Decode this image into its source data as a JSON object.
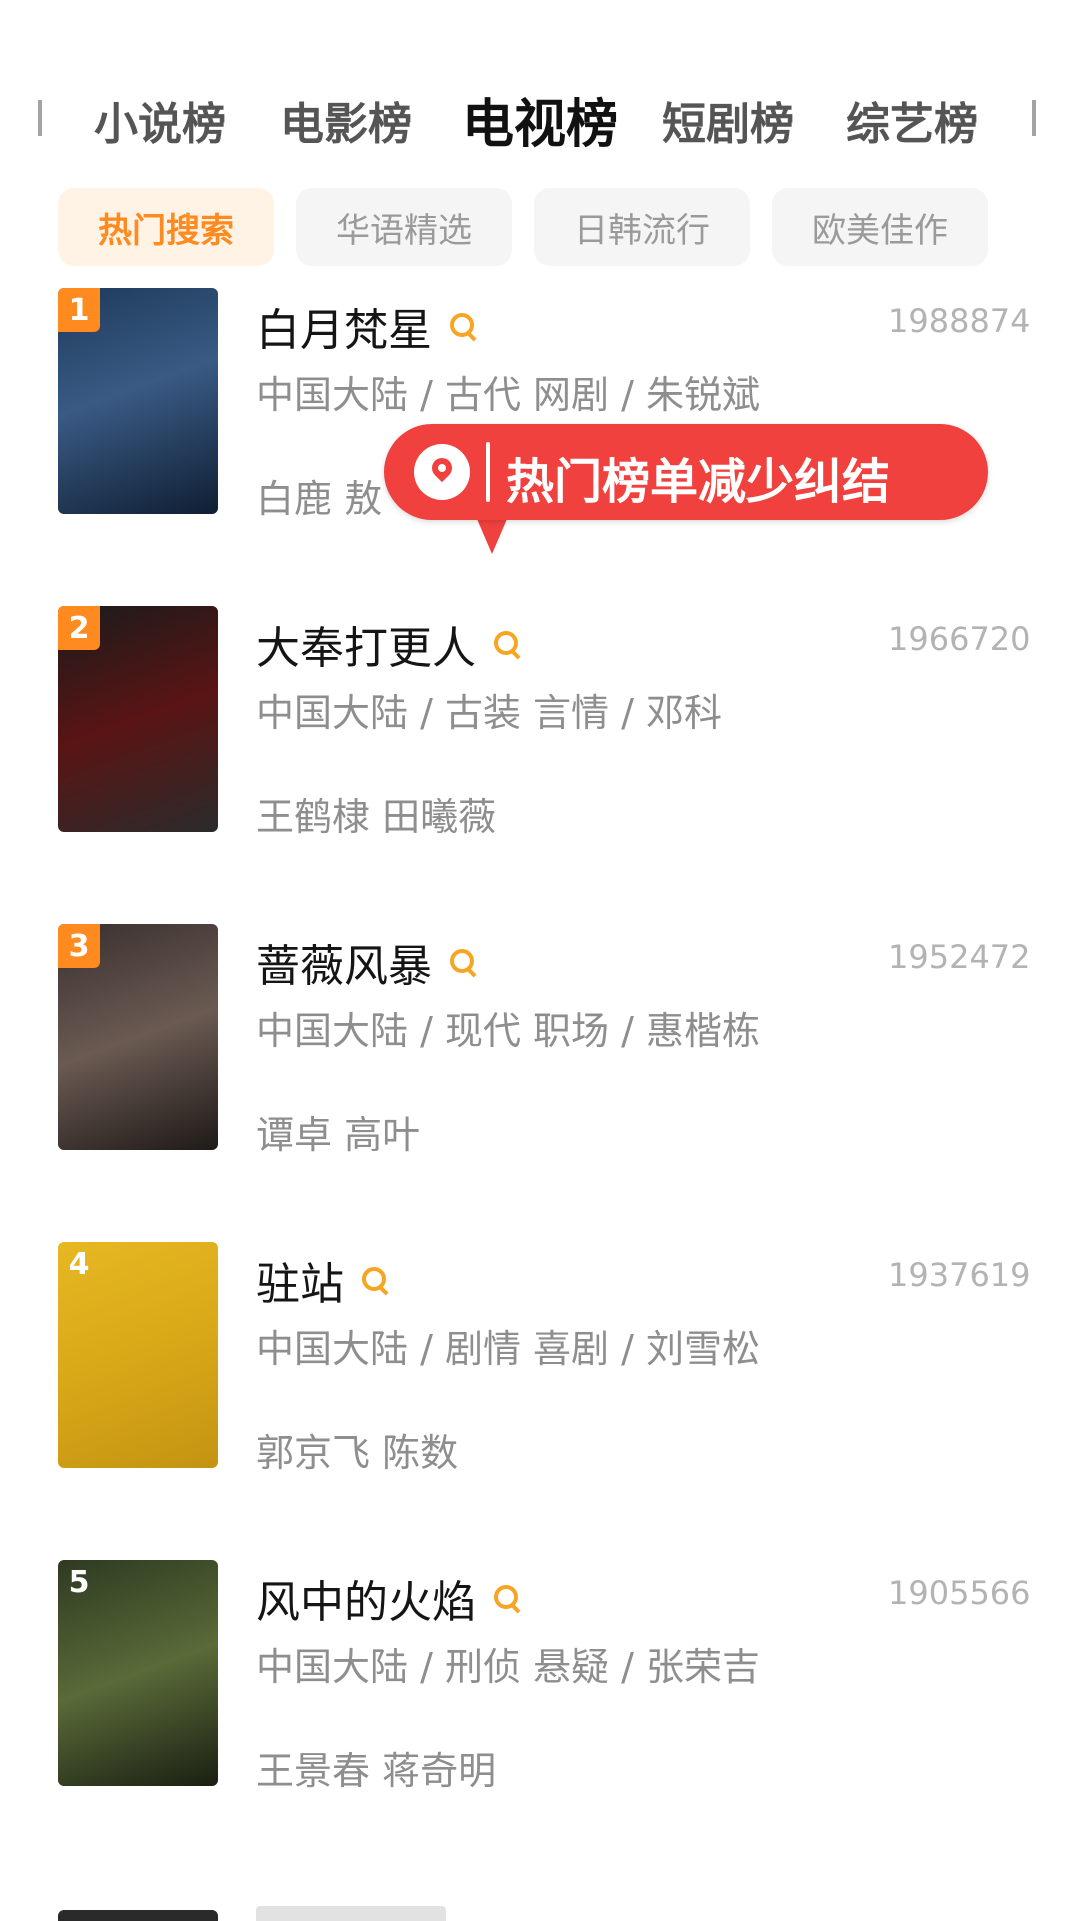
{
  "category_tabs": [
    {
      "label": "小说榜"
    },
    {
      "label": "电影榜"
    },
    {
      "label": "电视榜"
    },
    {
      "label": "短剧榜"
    },
    {
      "label": "综艺榜"
    }
  ],
  "active_category": "电视榜",
  "filter_chips": [
    {
      "label": "热门搜索"
    },
    {
      "label": "华语精选"
    },
    {
      "label": "日韩流行"
    },
    {
      "label": "欧美佳作"
    }
  ],
  "active_chip": "热门搜索",
  "items": [
    {
      "rank": "1",
      "title": "白月梵星",
      "score": "1988874",
      "meta": "中国大陆 / 古代 网剧 / 朱锐斌",
      "cast": "白鹿 敖",
      "poster_colors": [
        "#1d3b5a",
        "#3a5a84",
        "#0f1f33"
      ]
    },
    {
      "rank": "2",
      "title": "大奉打更人",
      "score": "1966720",
      "meta": "中国大陆 / 古装 言情 / 邓科",
      "cast": "王鹤棣 田曦薇",
      "poster_colors": [
        "#1b1b1b",
        "#5a1414",
        "#2b2b2b"
      ]
    },
    {
      "rank": "3",
      "title": "蔷薇风暴",
      "score": "1952472",
      "meta": "中国大陆 / 现代 职场 / 惠楷栋",
      "cast": "谭卓 高叶",
      "poster_colors": [
        "#3a3030",
        "#6a5a52",
        "#1f1a18"
      ]
    },
    {
      "rank": "4",
      "title": "驻站",
      "score": "1937619",
      "meta": "中国大陆 / 剧情 喜剧 / 刘雪松",
      "cast": "郭京飞 陈数",
      "poster_colors": [
        "#e6b822",
        "#d9a818",
        "#c49412"
      ]
    },
    {
      "rank": "5",
      "title": "风中的火焰",
      "score": "1905566",
      "meta": "中国大陆 / 刑侦 悬疑 / 张荣吉",
      "cast": "王景春 蒋奇明",
      "poster_colors": [
        "#2f3a22",
        "#5a6a38",
        "#1a1f12"
      ]
    }
  ],
  "overlay": {
    "text": "热门榜单减少纠结",
    "icon": "location-pin-icon",
    "color": "#f0413e"
  },
  "accent_color": "#ff8a1f"
}
